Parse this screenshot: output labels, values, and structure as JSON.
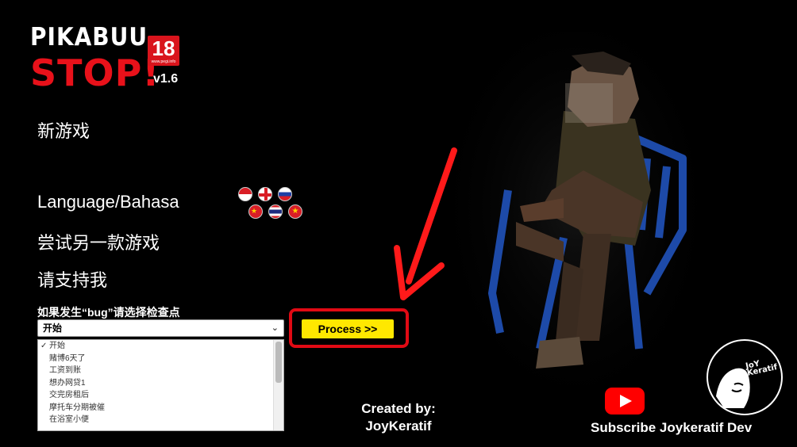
{
  "logo": {
    "line1": "PIKABUU",
    "line2": "STOP!",
    "age_rating": "18",
    "age_url": "www.pegi.info",
    "version": "v1.6"
  },
  "menu": {
    "new_game": "新游戏",
    "language": "Language/Bahasa",
    "try_another": "尝试另一款游戏",
    "support": "请支持我"
  },
  "language_flags": [
    "indonesia-flag",
    "england-flag",
    "russia-flag",
    "china-flag",
    "thailand-flag",
    "vietnam-flag"
  ],
  "checkpoint": {
    "label": "如果发生“bug”请选择检查点",
    "selected": "开始",
    "options": [
      "开始",
      "赌博6天了",
      "工资到账",
      "想办网贷1",
      "交完房租后",
      "摩托车分期被催",
      "在浴室小便"
    ]
  },
  "process_button": "Process >>",
  "credits": {
    "line1": "Created by:",
    "line2": "JoyKeratif"
  },
  "subscribe": "Subscribe Joykeratif Dev",
  "brand_logo_text": [
    "JoY",
    "Keratif"
  ],
  "colors": {
    "accent_red": "#e10a14",
    "button_yellow": "#ffe800",
    "background": "#000000"
  }
}
